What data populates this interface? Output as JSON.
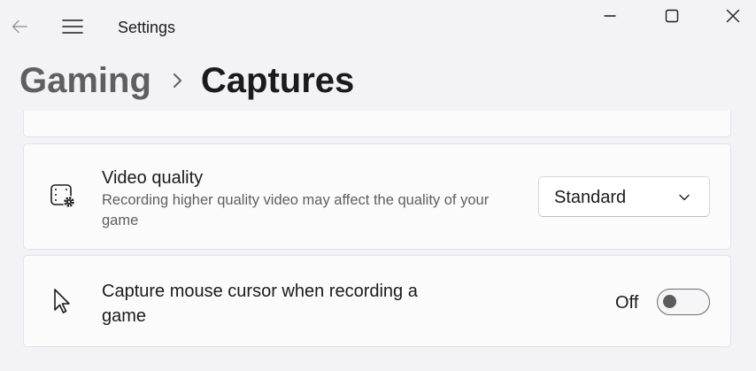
{
  "window": {
    "app_title": "Settings"
  },
  "breadcrumb": {
    "parent": "Gaming",
    "current": "Captures"
  },
  "settings": {
    "video_quality": {
      "title": "Video quality",
      "description": "Recording higher quality video may affect the quality of your game",
      "selected": "Standard",
      "icon": "video-settings-icon"
    },
    "capture_cursor": {
      "title": "Capture mouse cursor when recording a game",
      "state_label": "Off",
      "toggle_on": false,
      "icon": "mouse-pointer-icon"
    }
  },
  "colors": {
    "background": "#f3f3f7",
    "card": "#fbfbfc",
    "text_primary": "#1b1b1b",
    "text_secondary": "#5f5f5f"
  }
}
